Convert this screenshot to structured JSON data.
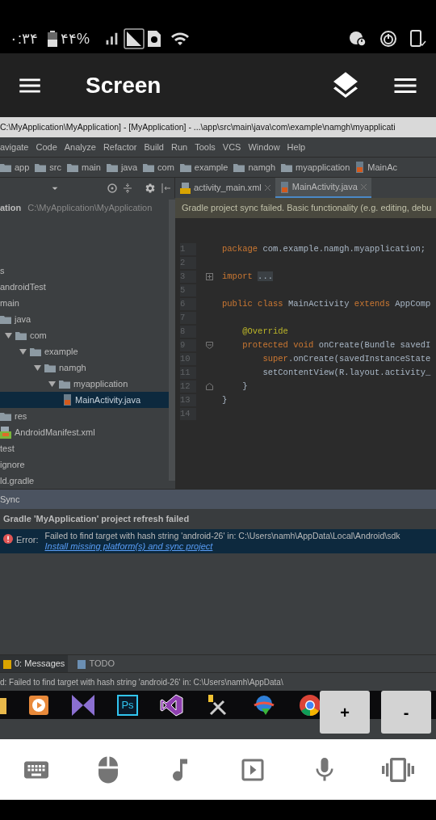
{
  "status_bar": {
    "time": "۰:۳۴",
    "battery": "۴۴%"
  },
  "app_bar": {
    "title": "Screen"
  },
  "ide": {
    "title_bar": "C:\\MyApplication\\MyApplication] - [MyApplication] - ...\\app\\src\\main\\java\\com\\example\\namgh\\myapplicati",
    "menu": [
      "avigate",
      "Code",
      "Analyze",
      "Refactor",
      "Build",
      "Run",
      "Tools",
      "VCS",
      "Window",
      "Help"
    ],
    "breadcrumbs": [
      {
        "label": "app",
        "kind": "folder"
      },
      {
        "label": "src",
        "kind": "folder"
      },
      {
        "label": "main",
        "kind": "folder"
      },
      {
        "label": "java",
        "kind": "folder"
      },
      {
        "label": "com",
        "kind": "folder"
      },
      {
        "label": "example",
        "kind": "folder"
      },
      {
        "label": "namgh",
        "kind": "folder"
      },
      {
        "label": "myapplication",
        "kind": "folder"
      },
      {
        "label": "MainAc",
        "kind": "java"
      }
    ],
    "tabs": [
      {
        "label": "activity_main.xml",
        "kind": "xml",
        "selected": false
      },
      {
        "label": "MainActivity.java",
        "kind": "java",
        "selected": true
      }
    ],
    "notification": "Gradle project sync failed. Basic functionality (e.g. editing, debu",
    "project_header": {
      "name": "ation",
      "path": "C:\\MyApplication\\MyApplication"
    },
    "tree": [
      {
        "label": "s",
        "selected": false,
        "children": [
          {
            "label": "androidTest",
            "selected": false
          },
          {
            "label": "main",
            "selected": false,
            "children": [
              {
                "label": "java",
                "kind": "folder",
                "selected": false,
                "children": [
                  {
                    "label": "com",
                    "kind": "folder",
                    "selected": false,
                    "expanded": true,
                    "children": [
                      {
                        "label": "example",
                        "kind": "folder",
                        "selected": false,
                        "expanded": true,
                        "children": [
                          {
                            "label": "namgh",
                            "kind": "folder",
                            "selected": false,
                            "expanded": true,
                            "children": [
                              {
                                "label": "myapplication",
                                "kind": "folder",
                                "selected": false,
                                "expanded": true,
                                "children": [
                                  {
                                    "label": "MainActivity.java",
                                    "kind": "java",
                                    "selected": true
                                  }
                                ]
                              }
                            ]
                          }
                        ]
                      }
                    ]
                  }
                ]
              },
              {
                "label": "res",
                "kind": "folder",
                "selected": false
              },
              {
                "label": "AndroidManifest.xml",
                "kind": "manifest",
                "selected": false
              }
            ]
          },
          {
            "label": "test",
            "selected": false
          }
        ]
      },
      {
        "label": "ignore",
        "selected": false
      },
      {
        "label": "ld.gradle",
        "selected": false
      }
    ],
    "code_lines": [
      {
        "number": "1",
        "kind": "code",
        "tokens": [
          {
            "text": "package",
            "kind": "keyword"
          },
          {
            "text": " com.example.namgh.myapplication;",
            "kind": "plain"
          }
        ]
      },
      {
        "number": "2",
        "kind": "code"
      },
      {
        "number": "3",
        "kind": "foldedregion",
        "tokens": [
          {
            "text": "import",
            "kind": "keyword"
          },
          {
            "text": "...",
            "kind": "folded"
          }
        ]
      },
      {
        "number": "5",
        "kind": "code"
      },
      {
        "number": "6",
        "kind": "code",
        "tokens": [
          {
            "text": "public class",
            "kind": "keyword"
          },
          {
            "text": " MainActivity ",
            "kind": "plain"
          },
          {
            "text": "extends",
            "kind": "keyword"
          },
          {
            "text": " AppComp",
            "kind": "plain"
          }
        ]
      },
      {
        "number": "7",
        "kind": "code"
      },
      {
        "number": "8",
        "kind": "code",
        "tokens": [
          {
            "text": "    @Override",
            "kind": "annotation"
          }
        ]
      },
      {
        "number": "9",
        "kind": "foldstart",
        "tokens": [
          {
            "text": "    protected void",
            "kind": "keyword"
          },
          {
            "text": " onCreate(Bundle savedI",
            "kind": "plain"
          }
        ]
      },
      {
        "number": "10",
        "kind": "code",
        "tokens": [
          {
            "text": "        super",
            "kind": "keyword"
          },
          {
            "text": ".onCreate(savedInstanceState",
            "kind": "plain"
          }
        ]
      },
      {
        "number": "11",
        "kind": "code",
        "tokens": [
          {
            "text": "        setContentView(R.layout.activity_",
            "kind": "plain"
          }
        ]
      },
      {
        "number": "12",
        "kind": "foldend",
        "tokens": [
          {
            "text": "    }",
            "kind": "plain"
          }
        ]
      },
      {
        "number": "13",
        "kind": "code",
        "tokens": [
          {
            "text": "}",
            "kind": "plain"
          }
        ]
      },
      {
        "number": "14",
        "kind": "code"
      }
    ],
    "sync": {
      "header": "Sync",
      "title": "Gradle 'MyApplication' project refresh failed",
      "error_label": "Error:",
      "message": "Failed to find target with hash string 'android-26' in: C:\\Users\\namh\\AppData\\Local\\Android\\sdk",
      "link": "Install missing platform(s) and sync project"
    },
    "tool_tabs": [
      {
        "label": "0: Messages",
        "kind": "messages",
        "selected": true
      },
      {
        "label": "TODO",
        "kind": "todo",
        "selected": false
      }
    ],
    "status_text": "d: Failed to find target with hash string 'android-26' in: C:\\Users\\namh\\AppData\\",
    "taskbar": [
      {
        "kind": "folder"
      },
      {
        "kind": "player"
      },
      {
        "kind": "kmplayer"
      },
      {
        "kind": "photoshop",
        "label": "Ps"
      },
      {
        "kind": "visualstudio"
      },
      {
        "kind": "tools"
      },
      {
        "kind": "download"
      },
      {
        "kind": "chrome"
      }
    ]
  },
  "zoom_buttons": [
    "+",
    "-"
  ]
}
